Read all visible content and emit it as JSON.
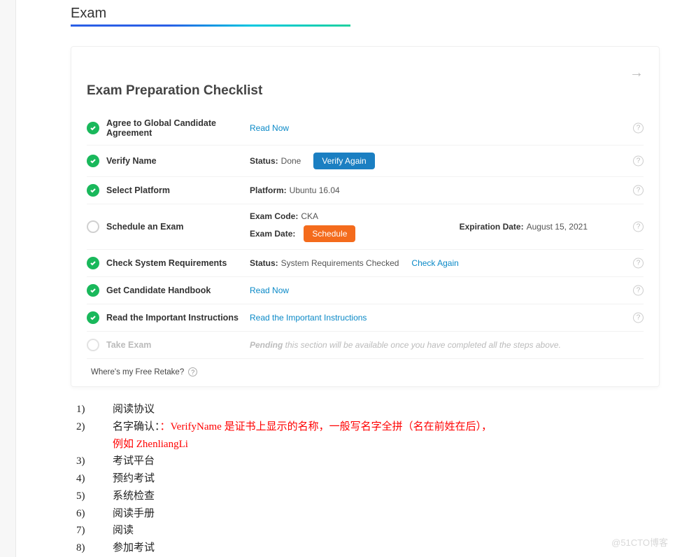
{
  "header": {
    "title": "Exam"
  },
  "card": {
    "title": "Exam Preparation Checklist",
    "retake_text": "Where's my Free Retake?"
  },
  "rows": {
    "agree": {
      "label": "Agree to Global Candidate Agreement",
      "action": "Read Now"
    },
    "verify": {
      "label": "Verify Name",
      "status_key": "Status:",
      "status_val": "Done",
      "action": "Verify Again"
    },
    "platform": {
      "label": "Select Platform",
      "platform_key": "Platform:",
      "platform_val": "Ubuntu 16.04"
    },
    "schedule": {
      "label": "Schedule an Exam",
      "code_key": "Exam Code:",
      "code_val": "CKA",
      "date_key": "Exam Date:",
      "action": "Schedule",
      "exp_key": "Expiration Date:",
      "exp_val": "August 15, 2021"
    },
    "sysreq": {
      "label": "Check System Requirements",
      "status_key": "Status:",
      "status_val": "System Requirements Checked",
      "action": "Check Again"
    },
    "handbook": {
      "label": "Get Candidate Handbook",
      "action": "Read Now"
    },
    "instructions": {
      "label": "Read the Important Instructions",
      "action": "Read the Important Instructions"
    },
    "take": {
      "label": "Take Exam",
      "pending_bold": "Pending",
      "pending_rest": " this section will be available once you have completed all the steps above."
    }
  },
  "notes": {
    "n1": {
      "num": "1)",
      "txt": "阅读协议"
    },
    "n2": {
      "num": "2)",
      "txt_black": "名字确认：",
      "txt_red": "：VerifyName 是证书上显示的名称，一般写名字全拼（名在前姓在后），",
      "txt_red2": "例如 ZhenliangLi"
    },
    "n3": {
      "num": "3)",
      "txt": "考试平台"
    },
    "n4": {
      "num": "4)",
      "txt": "预约考试"
    },
    "n5": {
      "num": "5)",
      "txt": "系统检查"
    },
    "n6": {
      "num": "6)",
      "txt": "阅读手册"
    },
    "n7": {
      "num": "7)",
      "txt": "阅读"
    },
    "n8": {
      "num": "8)",
      "txt": "参加考试"
    }
  },
  "watermark": "@51CTO博客"
}
